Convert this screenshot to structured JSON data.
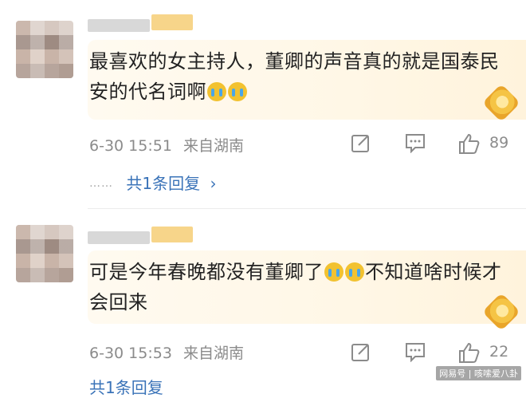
{
  "comments": [
    {
      "text_before": "最喜欢的女主持人，董卿的声音真的就是国泰民安的代名词啊",
      "text_after": "",
      "emoji_count": 2,
      "time": "6-30 15:51",
      "location": "来自湖南",
      "likes": "89",
      "replies_label": "共1条回复",
      "replies_chevron": "›"
    },
    {
      "text_before": "可是今年春晚都没有董卿了",
      "text_after": "不知道啥时候才会回来",
      "emoji_count": 2,
      "time": "6-30 15:53",
      "location": "来自湖南",
      "likes": "22",
      "replies_label": "共1条回复",
      "replies_chevron": "›"
    }
  ],
  "dots": "……",
  "watermark": "网易号 | 咳嗦爱八卦",
  "icons": {
    "edit": "share-edit-icon",
    "reply": "comment-icon",
    "like": "thumbs-up-icon",
    "badge": "vip-badge-icon"
  },
  "colors": {
    "link": "#3a73b8",
    "meta": "#8b8b8b",
    "bubble": "#fff7e6"
  }
}
